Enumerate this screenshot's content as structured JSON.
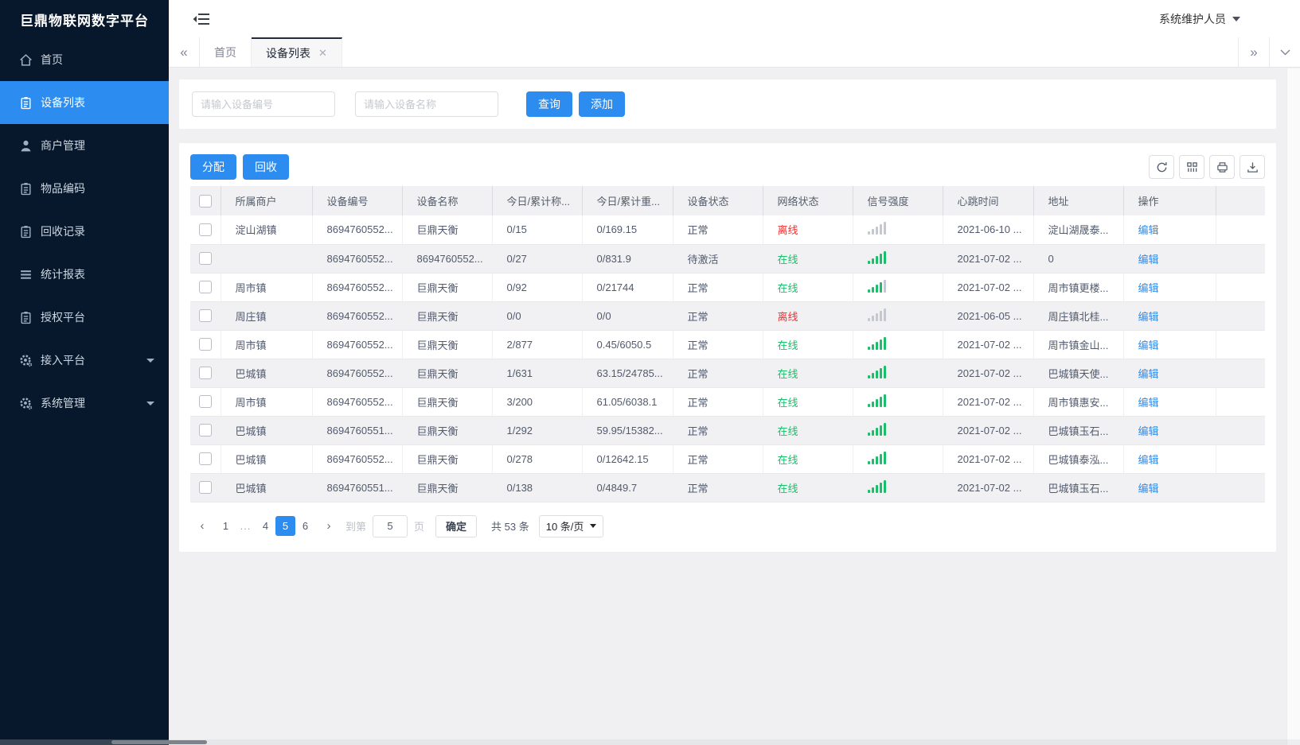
{
  "app": {
    "logo": "巨鼎物联网数字平台",
    "user": "系统维护人员"
  },
  "colors": {
    "primary": "#2d8cf0",
    "online": "#1cbe6b",
    "offline": "#f23030"
  },
  "sidebar": {
    "items": [
      {
        "label": "首页",
        "active": false
      },
      {
        "label": "设备列表",
        "active": true
      },
      {
        "label": "商户管理",
        "active": false
      },
      {
        "label": "物品编码",
        "active": false
      },
      {
        "label": "回收记录",
        "active": false
      },
      {
        "label": "统计报表",
        "active": false
      },
      {
        "label": "授权平台",
        "active": false
      },
      {
        "label": "接入平台",
        "active": false,
        "expandable": true
      },
      {
        "label": "系统管理",
        "active": false,
        "expandable": true
      }
    ]
  },
  "tabs": {
    "items": [
      {
        "label": "首页",
        "active": false,
        "closable": false
      },
      {
        "label": "设备列表",
        "active": true,
        "closable": true
      }
    ]
  },
  "search": {
    "device_no_placeholder": "请输入设备编号",
    "device_name_placeholder": "请输入设备名称",
    "query_label": "查询",
    "add_label": "添加"
  },
  "toolbar": {
    "assign_label": "分配",
    "recycle_label": "回收",
    "tool_icons": [
      "refresh",
      "columns",
      "print",
      "export"
    ]
  },
  "table": {
    "columns": [
      "所属商户",
      "设备编号",
      "设备名称",
      "今日/累计称...",
      "今日/累计重...",
      "设备状态",
      "网络状态",
      "信号强度",
      "心跳时间",
      "地址",
      "操作"
    ],
    "edit_label": "编辑",
    "rows": [
      {
        "merchant": "淀山湖镇",
        "device_no": "8694760552...",
        "device_name": "巨鼎天衡",
        "today_count": "0/15",
        "today_weight": "0/169.15",
        "device_status": "正常",
        "network_status": "离线",
        "signal_level": 0,
        "heartbeat": "2021-06-10 ...",
        "address": "淀山湖晟泰..."
      },
      {
        "merchant": "",
        "device_no": "8694760552...",
        "device_name": "8694760552...",
        "today_count": "0/27",
        "today_weight": "0/831.9",
        "device_status": "待激活",
        "network_status": "在线",
        "signal_level": 5,
        "heartbeat": "2021-07-02 ...",
        "address": "0"
      },
      {
        "merchant": "周市镇",
        "device_no": "8694760552...",
        "device_name": "巨鼎天衡",
        "today_count": "0/92",
        "today_weight": "0/21744",
        "device_status": "正常",
        "network_status": "在线",
        "signal_level": 4,
        "heartbeat": "2021-07-02 ...",
        "address": "周市镇更楼..."
      },
      {
        "merchant": "周庄镇",
        "device_no": "8694760552...",
        "device_name": "巨鼎天衡",
        "today_count": "0/0",
        "today_weight": "0/0",
        "device_status": "正常",
        "network_status": "离线",
        "signal_level": 0,
        "heartbeat": "2021-06-05 ...",
        "address": "周庄镇北桂..."
      },
      {
        "merchant": "周市镇",
        "device_no": "8694760552...",
        "device_name": "巨鼎天衡",
        "today_count": "2/877",
        "today_weight": "0.45/6050.5",
        "device_status": "正常",
        "network_status": "在线",
        "signal_level": 5,
        "heartbeat": "2021-07-02 ...",
        "address": "周市镇金山..."
      },
      {
        "merchant": "巴城镇",
        "device_no": "8694760552...",
        "device_name": "巨鼎天衡",
        "today_count": "1/631",
        "today_weight": "63.15/24785...",
        "device_status": "正常",
        "network_status": "在线",
        "signal_level": 5,
        "heartbeat": "2021-07-02 ...",
        "address": "巴城镇天使..."
      },
      {
        "merchant": "周市镇",
        "device_no": "8694760552...",
        "device_name": "巨鼎天衡",
        "today_count": "3/200",
        "today_weight": "61.05/6038.1",
        "device_status": "正常",
        "network_status": "在线",
        "signal_level": 5,
        "heartbeat": "2021-07-02 ...",
        "address": "周市镇惠安..."
      },
      {
        "merchant": "巴城镇",
        "device_no": "8694760551...",
        "device_name": "巨鼎天衡",
        "today_count": "1/292",
        "today_weight": "59.95/15382...",
        "device_status": "正常",
        "network_status": "在线",
        "signal_level": 5,
        "heartbeat": "2021-07-02 ...",
        "address": "巴城镇玉石..."
      },
      {
        "merchant": "巴城镇",
        "device_no": "8694760552...",
        "device_name": "巨鼎天衡",
        "today_count": "0/278",
        "today_weight": "0/12642.15",
        "device_status": "正常",
        "network_status": "在线",
        "signal_level": 5,
        "heartbeat": "2021-07-02 ...",
        "address": "巴城镇泰泓..."
      },
      {
        "merchant": "巴城镇",
        "device_no": "8694760551...",
        "device_name": "巨鼎天衡",
        "today_count": "0/138",
        "today_weight": "0/4849.7",
        "device_status": "正常",
        "network_status": "在线",
        "signal_level": 5,
        "heartbeat": "2021-07-02 ...",
        "address": "巴城镇玉石..."
      }
    ]
  },
  "pagination": {
    "pages": [
      "1",
      "...",
      "4",
      "5",
      "6"
    ],
    "active": "5",
    "goto_label": "到第",
    "goto_value": "5",
    "page_label": "页",
    "confirm_label": "确定",
    "total_label": "共 53 条",
    "page_size": "10 条/页"
  }
}
